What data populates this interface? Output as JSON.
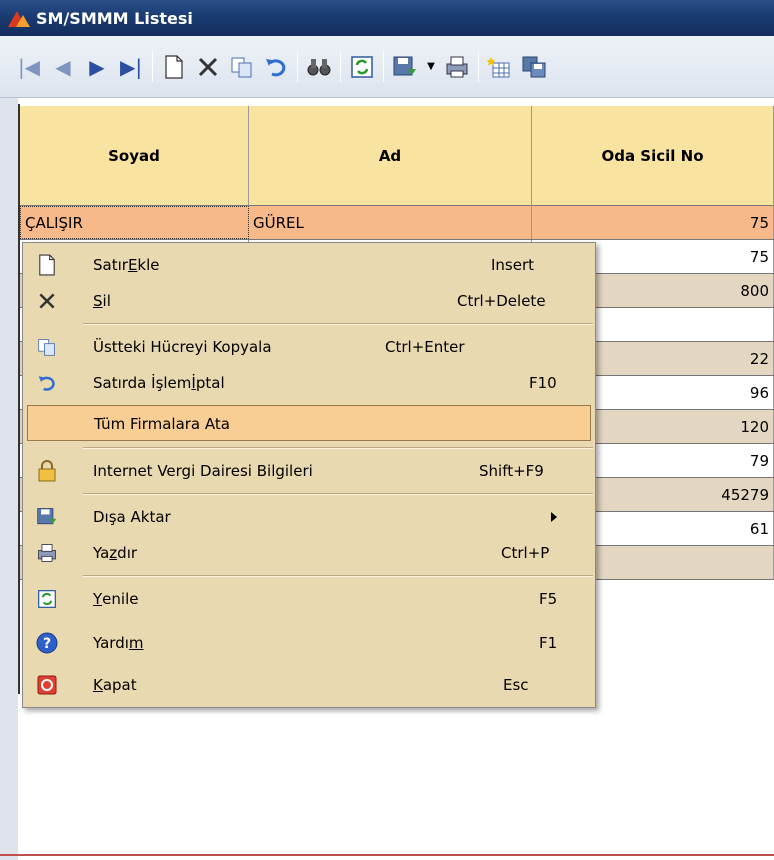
{
  "window": {
    "title": "SM/SMMM Listesi"
  },
  "grid": {
    "columns": [
      "Soyad",
      "Ad",
      "Oda Sicil No"
    ],
    "rows": [
      {
        "soyad": "ÇALIŞIR",
        "ad": "GÜREL",
        "sicil": "75"
      },
      {
        "soyad": "",
        "ad": "",
        "sicil": "75"
      },
      {
        "soyad": "",
        "ad": "",
        "sicil": "800"
      },
      {
        "soyad": "",
        "ad": "",
        "sicil": ""
      },
      {
        "soyad": "",
        "ad": "",
        "sicil": "22"
      },
      {
        "soyad": "",
        "ad": "",
        "sicil": "96"
      },
      {
        "soyad": "",
        "ad": "",
        "sicil": "120"
      },
      {
        "soyad": "",
        "ad": "",
        "sicil": "79"
      },
      {
        "soyad": "",
        "ad": "",
        "sicil": "45279"
      },
      {
        "soyad": "",
        "ad": "",
        "sicil": "61"
      },
      {
        "soyad": "",
        "ad": "",
        "sicil": ""
      }
    ]
  },
  "menu": {
    "add_row": {
      "pre": "Satır ",
      "u": "E",
      "post": "kle",
      "shortcut": "Insert"
    },
    "delete": {
      "pre": "",
      "u": "S",
      "post": "il",
      "shortcut": "Ctrl+Delete"
    },
    "copy_above": {
      "label": "Üstteki Hücreyi Kopyala",
      "shortcut": "Ctrl+Enter"
    },
    "cancel_row": {
      "pre": "Satırda İşlem ",
      "u": "İ",
      "post": "ptal",
      "shortcut": "F10"
    },
    "assign_all": {
      "label": "Tüm Firmalara Ata"
    },
    "tax_info": {
      "label": "Internet Vergi Dairesi Bilgileri",
      "shortcut": "Shift+F9"
    },
    "export": {
      "label": "Dışa Aktar"
    },
    "print": {
      "pre": "Ya",
      "u": "z",
      "post": "dır",
      "shortcut": "Ctrl+P"
    },
    "refresh": {
      "pre": "",
      "u": "Y",
      "post": "enile",
      "shortcut": "F5"
    },
    "help": {
      "pre": "Yardı",
      "u": "m",
      "post": "",
      "shortcut": "F1"
    },
    "close": {
      "pre": "",
      "u": "K",
      "post": "apat",
      "shortcut": "Esc"
    }
  },
  "colors": {
    "menu_bg": "#e9d9b0",
    "highlight": "#f9ce94",
    "header_bg": "#f9e3a0",
    "selected_row": "#f8b98a"
  }
}
